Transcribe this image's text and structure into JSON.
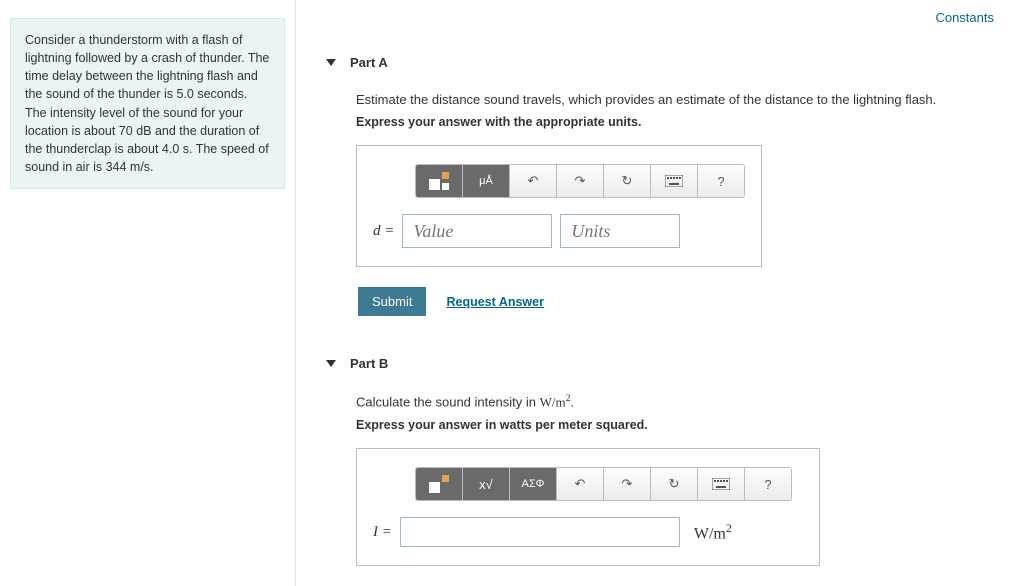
{
  "links": {
    "constants": "Constants"
  },
  "problem": {
    "text": "Consider a thunderstorm with a flash of lightning followed by a crash of thunder. The time delay between the lightning flash and the sound of the thunder is 5.0 seconds. The intensity level of the sound for your location is about 70 dB and the duration of the thunderclap is about 4.0 s. The speed of sound in air is 344 m/s."
  },
  "partA": {
    "title": "Part A",
    "prompt": "Estimate the distance sound travels, which provides an estimate of the distance to the lightning flash.",
    "instruction": "Express your answer with the appropriate units.",
    "var": "d =",
    "placeholder_value": "Value",
    "placeholder_units": "Units",
    "toolbar": {
      "unit_btn": "μÅ",
      "help": "?"
    },
    "submit": "Submit",
    "request": "Request Answer"
  },
  "partB": {
    "title": "Part B",
    "prompt_prefix": "Calculate the sound intensity in ",
    "prompt_units_html": "W/m",
    "prompt_suffix": ".",
    "instruction": "Express your answer in watts per meter squared.",
    "var": "I =",
    "units_display": "W/m",
    "toolbar": {
      "greek": "ΑΣΦ",
      "help": "?"
    }
  }
}
